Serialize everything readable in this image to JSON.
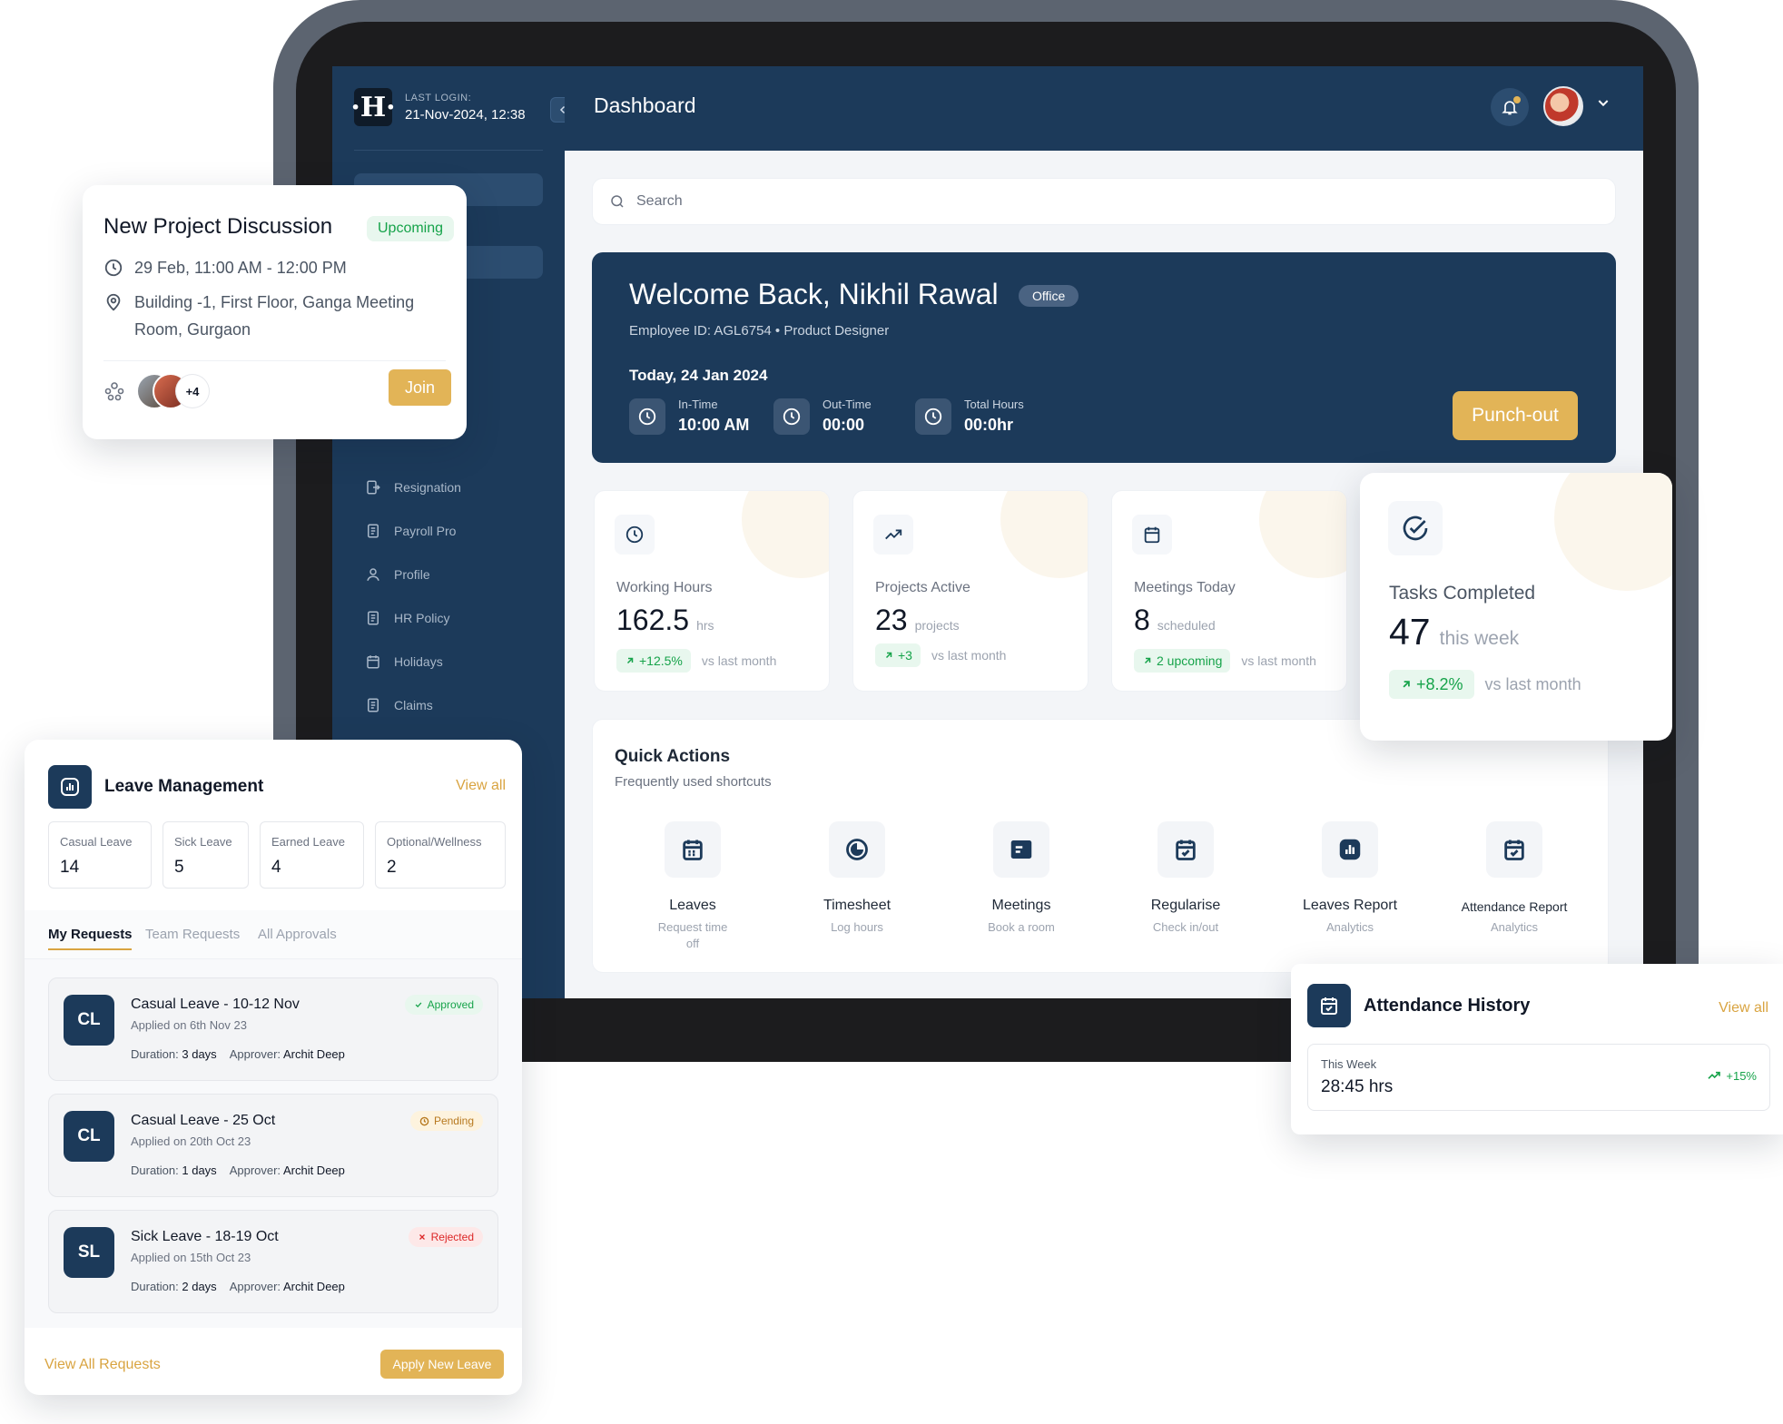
{
  "colors": {
    "navy": "#1c3a5a",
    "accent": "#e2b457",
    "success": "#16a34a",
    "warning": "#b7791f",
    "danger": "#dc2626"
  },
  "brand": {
    "logo_letter": "·H·",
    "last_login_label": "LAST LOGIN:",
    "last_login_value": "21-Nov-2024, 12:38"
  },
  "header": {
    "title": "Dashboard",
    "bell_icon": "bell-icon",
    "avatar_menu_icon": "chevron-down-icon"
  },
  "sidebar": {
    "items": [
      {
        "label": "Resignation",
        "icon": "logout-icon"
      },
      {
        "label": "Payroll Pro",
        "icon": "document-icon"
      },
      {
        "label": "Profile",
        "icon": "user-icon"
      },
      {
        "label": "HR Policy",
        "icon": "document-icon"
      },
      {
        "label": "Holidays",
        "icon": "calendar-icon"
      },
      {
        "label": "Claims",
        "icon": "document-icon"
      }
    ]
  },
  "search": {
    "placeholder": "Search"
  },
  "welcome": {
    "title": "Welcome Back, Nikhil Rawal",
    "badge": "Office",
    "meta": "Employee ID: AGL6754 • Product Designer",
    "today": "Today, 24 Jan 2024",
    "in_label": "In-Time",
    "in_value": "10:00 AM",
    "out_label": "Out-Time",
    "out_value": "00:00",
    "total_label": "Total Hours",
    "total_value": "00:0hr",
    "punch_label": "Punch-out"
  },
  "stats": [
    {
      "label": "Working Hours",
      "value": "162.5",
      "unit": "hrs",
      "trend": "+12.5%",
      "note": "vs last month",
      "icon": "clock-icon"
    },
    {
      "label": "Projects Active",
      "value": "23",
      "unit": "projects",
      "trend": "+3",
      "note": "vs last month",
      "icon": "trending-up-icon"
    },
    {
      "label": "Meetings Today",
      "value": "8",
      "unit": "scheduled",
      "trend": "2 upcoming",
      "note": "vs last month",
      "icon": "calendar-icon"
    }
  ],
  "tasks": {
    "label": "Tasks Completed",
    "value": "47",
    "unit": "this week",
    "trend": "+8.2%",
    "note": "vs last month"
  },
  "quick_actions": {
    "title": "Quick Actions",
    "subtitle": "Frequently used shortcuts",
    "items": [
      {
        "label": "Leaves",
        "desc": "Request time off",
        "icon": "calendar-icon"
      },
      {
        "label": "Timesheet",
        "desc": "Log hours",
        "icon": "clock-icon"
      },
      {
        "label": "Meetings",
        "desc": "Book a room",
        "icon": "meeting-room-icon"
      },
      {
        "label": "Regularise",
        "desc": "Check in/out",
        "icon": "calendar-check-icon"
      },
      {
        "label": "Leaves Report",
        "desc": "Analytics",
        "icon": "bar-chart-icon"
      },
      {
        "label": "Attendance Report",
        "desc": "Analytics",
        "icon": "calendar-check-icon"
      }
    ]
  },
  "meeting": {
    "title": "New Project Discussion",
    "status": "Upcoming",
    "time": "29 Feb, 11:00 AM - 12:00 PM",
    "location": "Building -1, First Floor, Ganga Meeting Room, Gurgaon",
    "more_count": "+4",
    "join_label": "Join"
  },
  "leave": {
    "title": "Leave Management",
    "view_all": "View all",
    "balances": [
      {
        "label": "Casual Leave",
        "value": "14"
      },
      {
        "label": "Sick Leave",
        "value": "5"
      },
      {
        "label": "Earned Leave",
        "value": "4"
      },
      {
        "label": "Optional/Wellness",
        "value": "2"
      }
    ],
    "tabs": [
      "My Requests",
      "Team Requests",
      "All Approvals"
    ],
    "requests": [
      {
        "code": "CL",
        "title": "Casual Leave - 10-12 Nov",
        "applied": "Applied on 6th Nov 23",
        "duration_label": "Duration:",
        "duration": "3 days",
        "approver_label": "Approver:",
        "approver": "Archit Deep",
        "status": "Approved",
        "status_icon": "check-icon"
      },
      {
        "code": "CL",
        "title": "Casual Leave - 25 Oct",
        "applied": "Applied on 20th Oct 23",
        "duration_label": "Duration:",
        "duration": "1 days",
        "approver_label": "Approver:",
        "approver": "Archit Deep",
        "status": "Pending",
        "status_icon": "clock-icon"
      },
      {
        "code": "SL",
        "title": "Sick Leave - 18-19 Oct",
        "applied": "Applied on 15th Oct 23",
        "duration_label": "Duration:",
        "duration": "2 days",
        "approver_label": "Approver:",
        "approver": "Archit Deep",
        "status": "Rejected",
        "status_icon": "close-icon"
      }
    ],
    "view_all_requests": "View All Requests",
    "apply_label": "Apply New Leave"
  },
  "attendance": {
    "title": "Attendance History",
    "view_all": "View all",
    "week_label": "This Week",
    "week_value": "28:45 hrs",
    "trend": "+15%"
  }
}
